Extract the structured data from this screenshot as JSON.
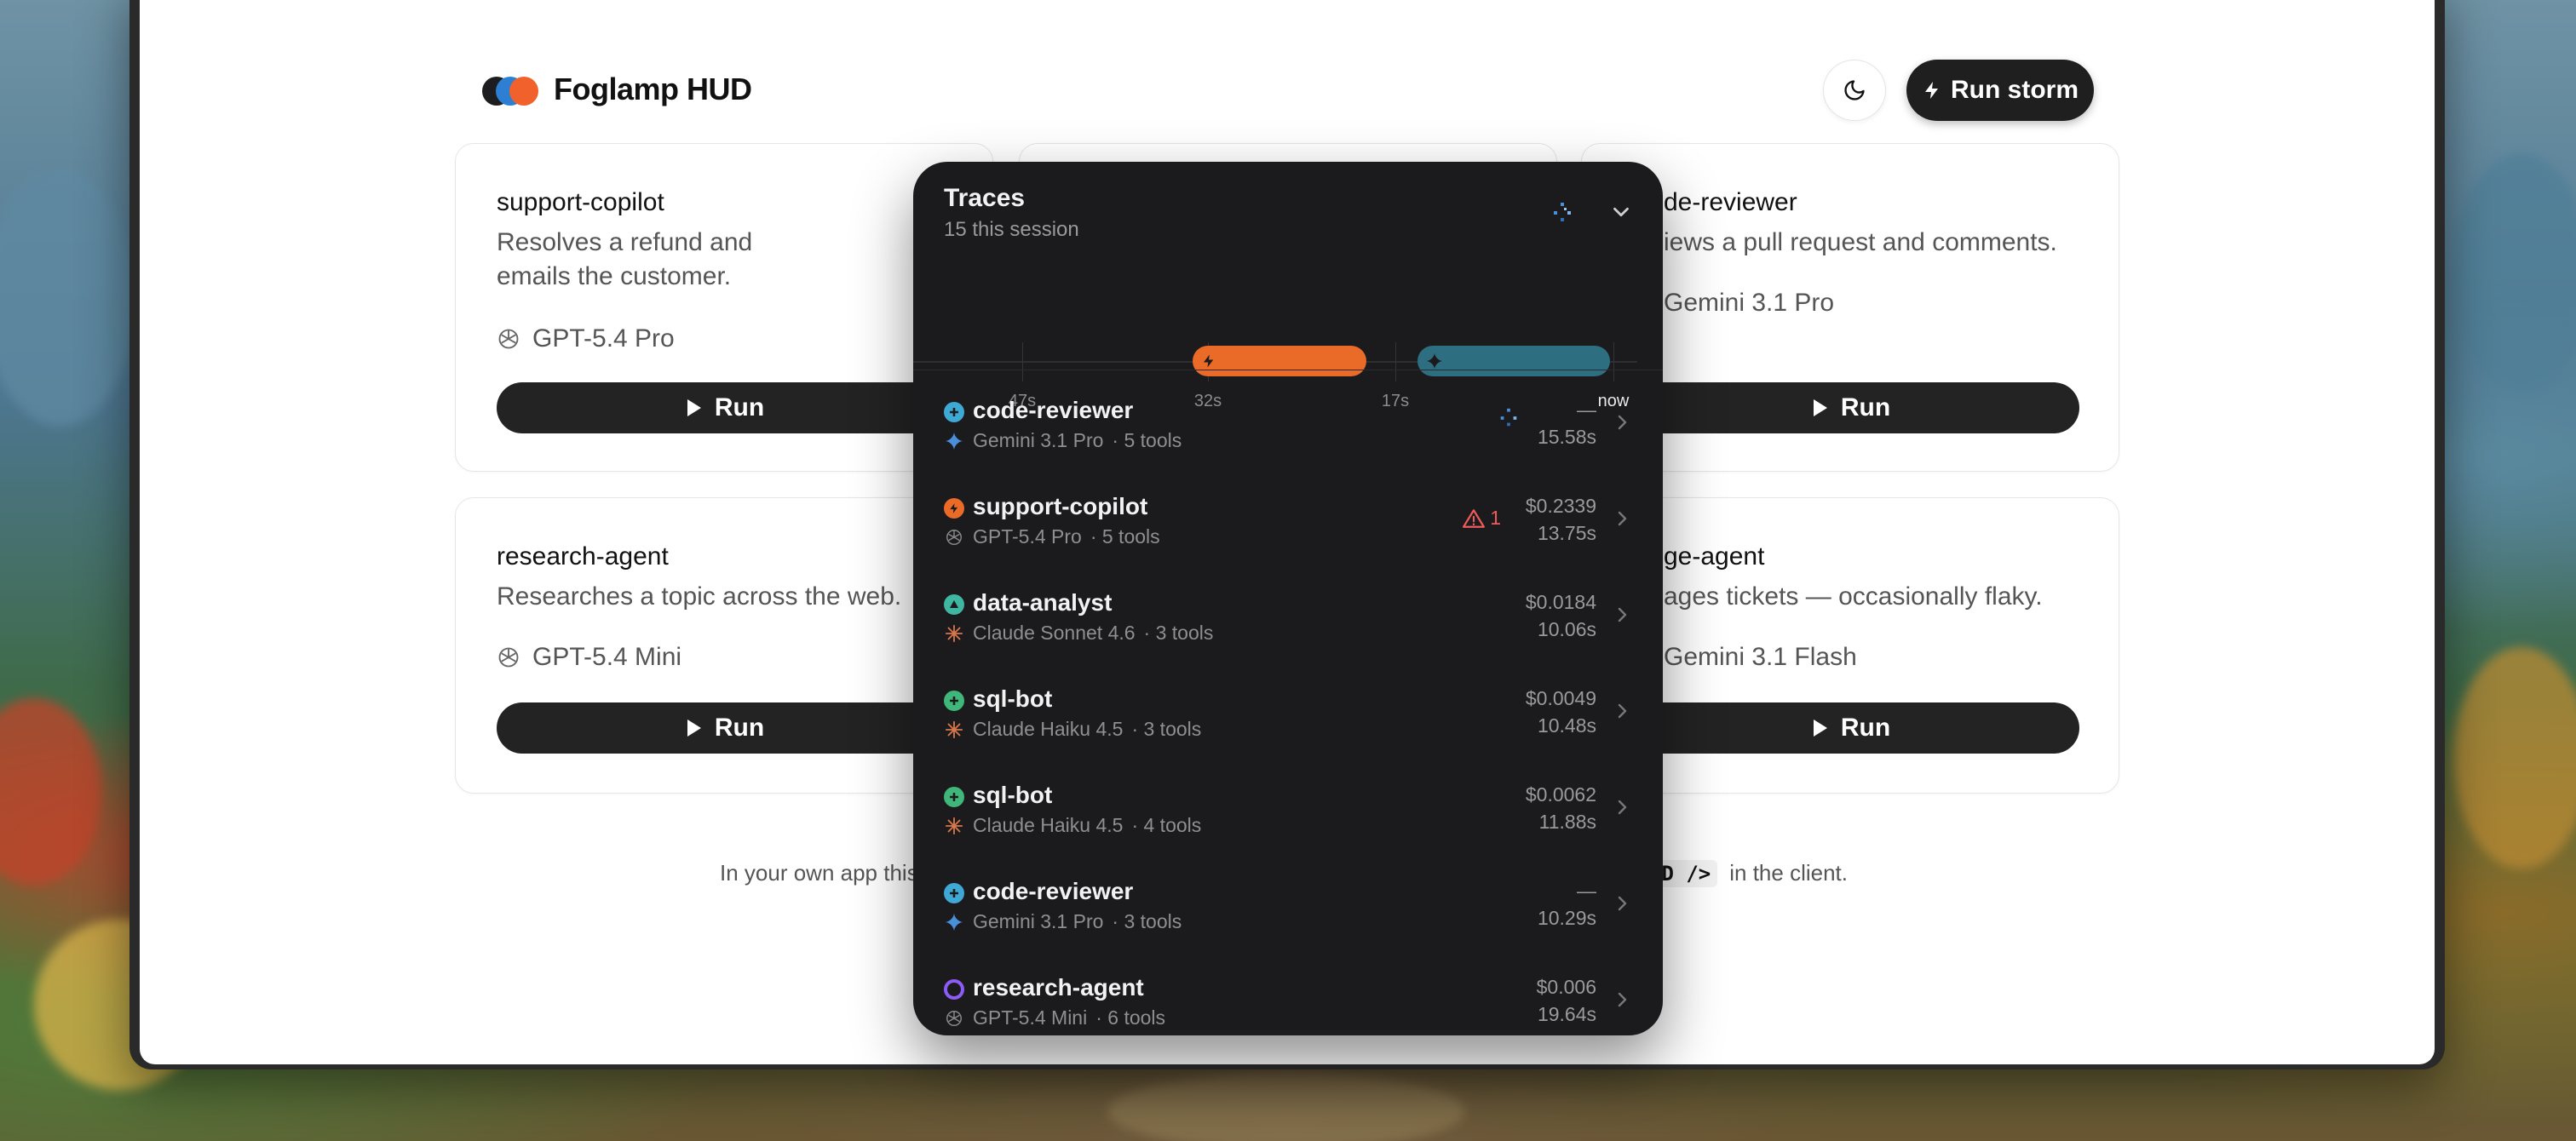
{
  "app": {
    "brand": "Foglamp HUD",
    "run_storm_label": "Run storm"
  },
  "cards": [
    {
      "title": "support-copilot",
      "desc": "Resolves a refund and emails the customer.",
      "model": "GPT-5.4 Pro",
      "model_icon": "openai-icon",
      "run_label": "Run"
    },
    {
      "title": "de-reviewer",
      "desc": "iews a pull request and comments.",
      "model": "Gemini 3.1 Pro",
      "model_icon": "gemini-icon",
      "run_label": "Run"
    },
    {
      "title": "research-agent",
      "desc": "Researches a topic across the web.",
      "model": "GPT-5.4 Mini",
      "model_icon": "openai-icon",
      "run_label": "Run"
    },
    {
      "title": "ge-agent",
      "desc": "ages tickets — occasionally flaky.",
      "model": "Gemini 3.1 Flash",
      "model_icon": "gemini-icon",
      "run_label": "Run"
    }
  ],
  "footnote": {
    "left": "In your own app this",
    "code": "UD />",
    "right": "in the client."
  },
  "traces": {
    "title": "Traces",
    "subtitle": "15 this session",
    "timeline_ticks": [
      "47s",
      "32s",
      "17s",
      "now"
    ],
    "rows": [
      {
        "agent": "code-reviewer",
        "status": "running",
        "status_color": "#3fa9d6",
        "model": "Gemini 3.1 Pro",
        "model_icon": "gemini-icon",
        "tools": "· 5 tools",
        "cost": "—",
        "duration": "15.58s"
      },
      {
        "agent": "support-copilot",
        "status": "error",
        "status_color": "#ea6a28",
        "model": "GPT-5.4 Pro",
        "model_icon": "openai-icon",
        "tools": "· 5 tools",
        "cost": "$0.2339",
        "duration": "13.75s",
        "warnings": "1"
      },
      {
        "agent": "data-analyst",
        "status": "success",
        "status_color": "#3fb6a2",
        "model": "Claude Sonnet 4.6",
        "model_icon": "claude-icon",
        "tools": "· 3 tools",
        "cost": "$0.0184",
        "duration": "10.06s"
      },
      {
        "agent": "sql-bot",
        "status": "success",
        "status_color": "#3fb67a",
        "model": "Claude Haiku 4.5",
        "model_icon": "claude-icon",
        "tools": "· 3 tools",
        "cost": "$0.0049",
        "duration": "10.48s"
      },
      {
        "agent": "sql-bot",
        "status": "success",
        "status_color": "#3fb67a",
        "model": "Claude Haiku 4.5",
        "model_icon": "claude-icon",
        "tools": "· 4 tools",
        "cost": "$0.0062",
        "duration": "11.88s"
      },
      {
        "agent": "code-reviewer",
        "status": "success",
        "status_color": "#3fa9d6",
        "model": "Gemini 3.1 Pro",
        "model_icon": "gemini-icon",
        "tools": "· 3 tools",
        "cost": "—",
        "duration": "10.29s"
      },
      {
        "agent": "research-agent",
        "status": "pending",
        "status_color": "#8b5cf6",
        "model": "GPT-5.4 Mini",
        "model_icon": "openai-icon",
        "tools": "· 6 tools",
        "cost": "$0.006",
        "duration": "19.64s"
      }
    ]
  }
}
